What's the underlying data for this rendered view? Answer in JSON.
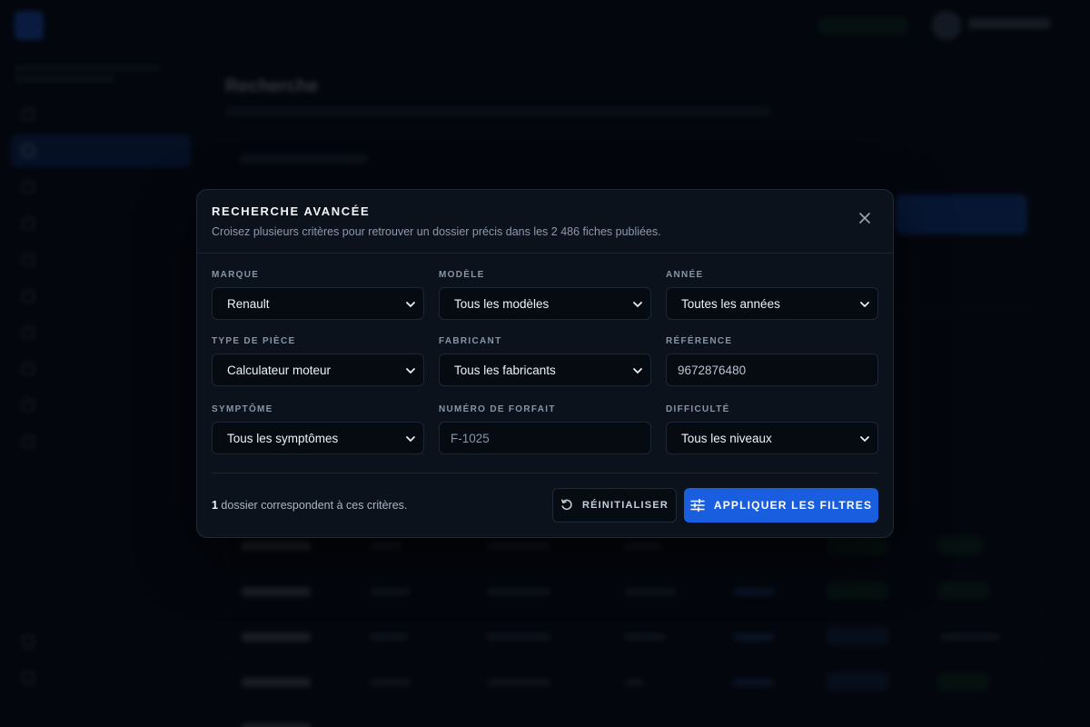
{
  "modal": {
    "title": "RECHERCHE AVANCÉE",
    "subtitle": "Croisez plusieurs critères pour retrouver un dossier précis dans les 2 486 fiches publiées.",
    "close_icon": "close-icon"
  },
  "fields": {
    "marque": {
      "label": "MARQUE",
      "value": "Renault"
    },
    "modele": {
      "label": "MODÈLE",
      "value": "Tous les modèles"
    },
    "annee": {
      "label": "ANNÉE",
      "value": "Toutes les années"
    },
    "type_piece": {
      "label": "TYPE DE PIÈCE",
      "value": "Calculateur moteur"
    },
    "fabricant": {
      "label": "FABRICANT",
      "value": "Tous les fabricants"
    },
    "reference": {
      "label": "RÉFÉRENCE",
      "value": "9672876480",
      "placeholder": ""
    },
    "symptome": {
      "label": "SYMPTÔME",
      "value": "Tous les symptômes"
    },
    "forfait": {
      "label": "NUMÉRO DE FORFAIT",
      "value": "",
      "placeholder": "F-1025"
    },
    "difficulte": {
      "label": "DIFFICULTÉ",
      "value": "Tous les niveaux"
    }
  },
  "footer": {
    "result_count": "1",
    "result_suffix": " dossier correspondent à ces critères.",
    "reset_label": "RÉINITIALISER",
    "apply_label": "APPLIQUER LES FILTRES"
  },
  "background": {
    "page_title": "Recherche"
  },
  "colors": {
    "accent": "#1a5ee0",
    "modal_bg": "#0b121b",
    "page_bg": "#05090f"
  }
}
